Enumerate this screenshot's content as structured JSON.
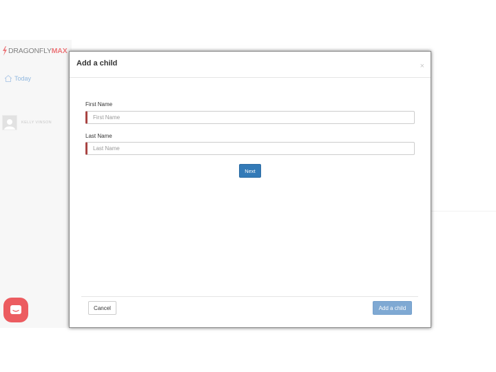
{
  "sidebar": {
    "logo": {
      "brand_main": "DRAGONFLY",
      "brand_accent": "MAX"
    },
    "nav": [
      {
        "label": "Today",
        "icon": "home-icon"
      }
    ],
    "profile": {
      "name": "KELLY VINSON"
    }
  },
  "modal": {
    "title": "Add a child",
    "close_glyph": "×",
    "first_name": {
      "label": "First Name",
      "placeholder": "First Name",
      "value": ""
    },
    "last_name": {
      "label": "Last Name",
      "placeholder": "Last Name",
      "value": ""
    },
    "next_label": "Next",
    "cancel_label": "Cancel",
    "add_child_label": "Add a child"
  },
  "colors": {
    "accent_red": "#e5484d",
    "primary_blue": "#337ab7",
    "disabled_blue": "#7fa9d3",
    "required_marker": "#a94442",
    "nav_link": "#6a9fd4"
  }
}
